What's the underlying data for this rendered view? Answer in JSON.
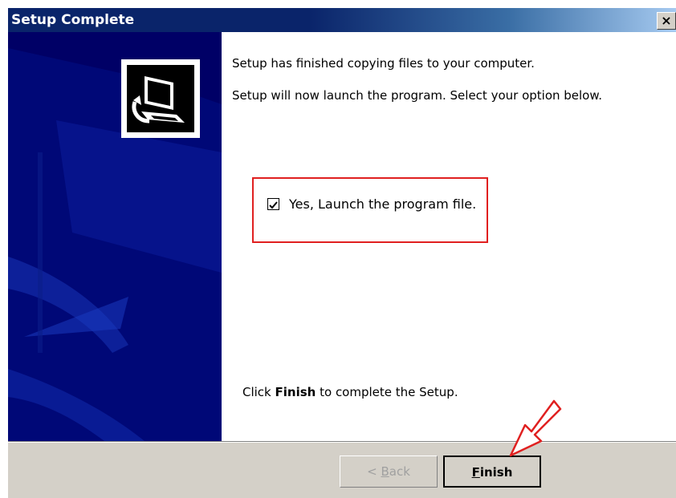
{
  "window": {
    "title": "Setup Complete",
    "close_glyph": "×"
  },
  "content": {
    "line1": "Setup has finished copying files to your computer.",
    "line2": "Setup will now launch the program. Select your option below.",
    "checkbox_label": "Yes, Launch the program file.",
    "checkbox_checked": true,
    "finish_prefix": "Click ",
    "finish_bold": "Finish",
    "finish_suffix": " to complete the Setup."
  },
  "buttons": {
    "back_prefix": "< ",
    "back_mnemonic": "B",
    "back_rest": "ack",
    "back_enabled": false,
    "finish_mnemonic": "F",
    "finish_rest": "inish"
  },
  "colors": {
    "banner": "#000066",
    "highlight": "#e02020",
    "annotation_arrow": "#e02020"
  },
  "icons": {
    "logo": "computer-install-icon",
    "checkbox": "checkmark-icon",
    "annotation": "pointer-arrow-icon"
  }
}
